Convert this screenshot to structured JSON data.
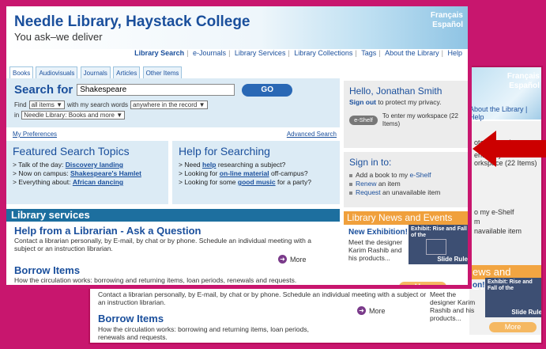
{
  "header": {
    "title": "Needle Library, Haystack College",
    "tagline": "You ask–we deliver",
    "languages": [
      "Français",
      "Español"
    ]
  },
  "topnav": [
    "Library Search",
    "e-Journals",
    "Library Services",
    "Library Collections",
    "Tags",
    "About the Library",
    "Help"
  ],
  "tabs": [
    "Books",
    "Audiovisuals",
    "Journals",
    "Articles",
    "Other Items"
  ],
  "search": {
    "label": "Search for",
    "value": "Shakespeare",
    "go": "GO",
    "find_label": "Find",
    "find_value": "all items",
    "with_label": "with my search words",
    "where_value": "anywhere in the record",
    "in_label": "in",
    "in_value": "Needle Library: Books and more",
    "preferences": "My Preferences",
    "advanced": "Advanced Search"
  },
  "featured": {
    "title": "Featured Search Topics",
    "items": [
      {
        "pre": "> Talk of the day: ",
        "link": "Discovery landing",
        "post": ""
      },
      {
        "pre": "> Now on campus: ",
        "link": "Shakespeare's Hamlet",
        "post": ""
      },
      {
        "pre": "> Everything about: ",
        "link": "African dancing",
        "post": ""
      }
    ]
  },
  "help": {
    "title": "Help for Searching",
    "items": [
      {
        "pre": "> Need ",
        "link": "help",
        "post": " researching a subject?"
      },
      {
        "pre": "> Looking for ",
        "link": "on-line material",
        "post": " off-campus?"
      },
      {
        "pre": "> Looking for some ",
        "link": "good music",
        "post": " for a party?"
      }
    ]
  },
  "library_services": {
    "title": "Library services",
    "items": [
      {
        "title": "Help from a Librarian - Ask a Question",
        "desc": "Contact a librarian personally, by E-mail, by chat or by phone. Schedule an individual meeting with a subject or an instruction librarian."
      },
      {
        "title": "Borrow Items",
        "desc": "How the circulation works: borrowing and returning items, loan periods, renewals and requests."
      }
    ],
    "more": "More"
  },
  "user": {
    "greeting": "Hello, Jonathan Smith",
    "signout_link": "Sign out",
    "signout_text": " to protect my privacy.",
    "eshelf_button": "e-Shelf",
    "eshelf_text": "To enter my workspace (22 Items)"
  },
  "signin": {
    "title": "Sign in to:",
    "items": [
      {
        "pre": "Add a book to my ",
        "link": "e-Shelf",
        "post": ""
      },
      {
        "pre": "",
        "link": "Renew",
        "post": " an item"
      },
      {
        "pre": "",
        "link": "Request",
        "post": " an unavailable item"
      }
    ]
  },
  "news": {
    "title": "Library News and Events",
    "heading": "New Exhibition!",
    "desc": "Meet the designer Karim Rashib and his products...",
    "exhibit_label": "Exhibit: Rise and Fall of the",
    "exhibit_footer": "Slide Rule",
    "more": "More"
  },
  "background_window": {
    "languages": [
      "Français",
      "Español"
    ],
    "nav": "About the Library | Help",
    "user_partial": [
      "otect my privacy.",
      "enter my",
      "orkspace (22 Items)",
      "o my e-Shelf",
      "m",
      "navailable item"
    ],
    "news_partial": "ews and Events",
    "news_heading_partial": "on!",
    "desc": "Contact a librarian personally, by E-mail, by chat or by phone. Schedule an individual meeting with a subject or an instruction librarian.",
    "borrow_title": "Borrow Items",
    "borrow_desc": "How the circulation works: borrowing and returning items, loan periods, renewals and requests.",
    "more": "More",
    "news_desc": "Meet the designer Karim Rashib and his products...",
    "exhibit_label": "Exhibit: Rise and Fall of the",
    "exhibit_footer": "Slide Rule"
  },
  "colors": {
    "frame": "#c8166e",
    "accent": "#1a4f9c",
    "arrow": "#cc0000"
  }
}
